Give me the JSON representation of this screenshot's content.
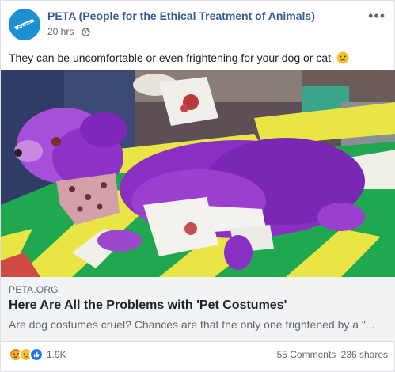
{
  "post": {
    "page_name": "PETA (People for the Ethical Treatment of Animals)",
    "time": "20 hrs",
    "separator": "·",
    "privacy_icon": "globe-icon",
    "avatar_text": "PETA",
    "more_icon": "more-options-icon",
    "caption": "They can be uncomfortable or even frightening for your dog or cat",
    "caption_emoji": "crying-face-emoji"
  },
  "link": {
    "domain": "PETA.ORG",
    "title": "Here Are All the Problems with 'Pet Costumes'",
    "description": "Are dog costumes cruel? Chances are that the only one frightened by a \"..."
  },
  "footer": {
    "reaction_icons": [
      "angry-reaction-icon",
      "sad-reaction-icon",
      "like-reaction-icon"
    ],
    "reaction_count": "1.9K",
    "comments": "55 Comments",
    "shares": "236 shares"
  },
  "colors": {
    "page_name": "#385898",
    "avatar_bg": "#1d8fd3",
    "link_bg": "#f2f3f5",
    "dog_purple": "#8a2fc4"
  }
}
